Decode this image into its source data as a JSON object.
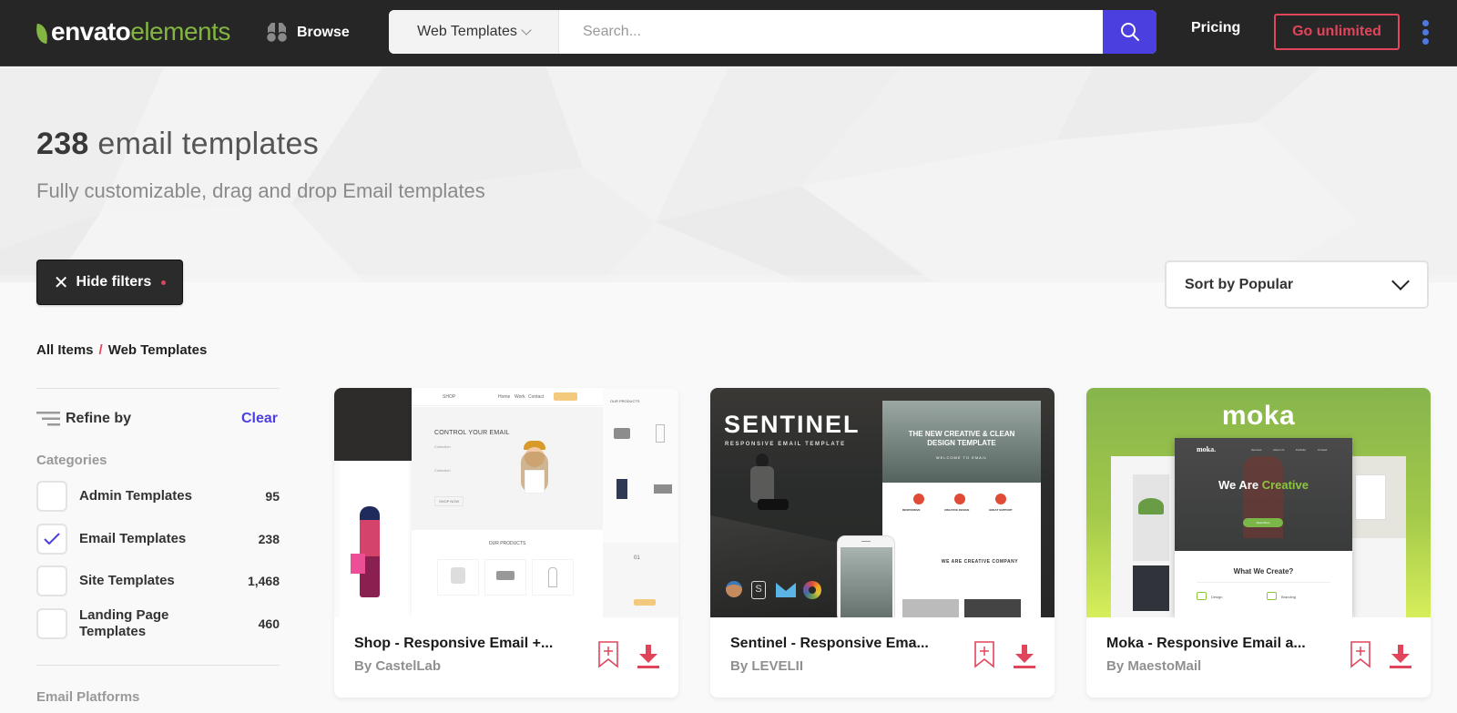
{
  "nav": {
    "logo_envato": "envato",
    "logo_elements": "elements",
    "browse_label": "Browse",
    "search_category": "Web Templates",
    "search_placeholder": "Search...",
    "search_value": "",
    "pricing_label": "Pricing",
    "go_unlimited_label": "Go unlimited",
    "icons": {
      "logo": "leaf-icon",
      "browse": "binoculars-icon",
      "search": "search-icon",
      "more": "kebab-menu-icon"
    }
  },
  "hero": {
    "count": "238",
    "title_rest": "email templates",
    "subtitle": "Fully customizable, drag and drop Email templates"
  },
  "filters_button": {
    "label": "Hide filters",
    "icon": "close-icon"
  },
  "sort": {
    "label": "Sort by Popular"
  },
  "breadcrumb": {
    "root": "All Items",
    "separator": "/",
    "current": "Web Templates"
  },
  "sidebar": {
    "refine_label": "Refine by",
    "clear_label": "Clear",
    "categories_heading": "Categories",
    "categories": [
      {
        "label": "Admin Templates",
        "count": "95",
        "checked": false
      },
      {
        "label": "Email Templates",
        "count": "238",
        "checked": true
      },
      {
        "label": "Site Templates",
        "count": "1,468",
        "checked": false
      },
      {
        "label": "Landing Page Templates",
        "count": "460",
        "checked": false
      }
    ],
    "platforms_heading": "Email Platforms"
  },
  "cards": [
    {
      "title": "Shop - Responsive Email +...",
      "author": "By CastelLab",
      "thumb": {
        "heading": "CONTROL YOUR EMAIL",
        "nav_brand": "SHOP",
        "nav_links": [
          "Home",
          "Work",
          "Contact"
        ],
        "products_label": "OUR PRODUCTS",
        "collection_label": "Collection",
        "shop_now": "SHOP NOW",
        "number": "01"
      }
    },
    {
      "title": "Sentinel - Responsive Ema...",
      "author": "By LEVELII",
      "thumb": {
        "brand": "SENTINEL",
        "tagline": "RESPONSIVE EMAIL TEMPLATE",
        "hero_text": "THE NEW CREATIVE & CLEAN DESIGN TEMPLATE",
        "welcome": "WELCOME TO EMAIL",
        "features": [
          "RESPONSIVE",
          "CREATIVE DESIGN",
          "GREAT SUPPORT"
        ],
        "company": "WE ARE CREATIVE COMPANY"
      }
    },
    {
      "title": "Moka - Responsive Email a...",
      "author": "By MaestoMail",
      "thumb": {
        "brand": "moka",
        "nav_brand": "moka.",
        "nav_links": [
          "Services",
          "About Us",
          "Portfolio",
          "Contact"
        ],
        "headline_a": "We Are",
        "headline_b": "Creative",
        "button": "Read More",
        "services_heading": "What We Create?",
        "services": [
          "Design",
          "Branding"
        ]
      }
    }
  ],
  "colors": {
    "accent": "#4b3fe0",
    "brand_green": "#82b541",
    "danger": "#e0455b",
    "nav_bg": "#262626"
  }
}
